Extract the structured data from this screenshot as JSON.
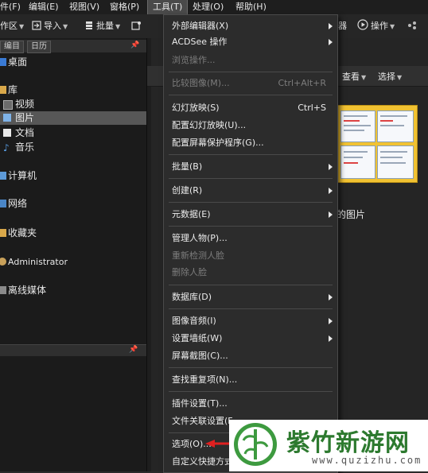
{
  "menubar": {
    "items": [
      {
        "label": "件(F)"
      },
      {
        "label": "编辑(E)"
      },
      {
        "label": "视图(V)"
      },
      {
        "label": "窗格(P)"
      },
      {
        "label": "工具(T)"
      },
      {
        "label": "处理(O)"
      },
      {
        "label": "帮助(H)"
      }
    ]
  },
  "toolbar": {
    "workspace_label": "作区",
    "import_label": "导入",
    "batch_label": "批量",
    "right_partial_label": "器",
    "action_label": "操作"
  },
  "left_panel": {
    "tabs": [
      "编目",
      "日历"
    ],
    "tree": [
      {
        "label": "桌面"
      },
      {
        "label": "库"
      },
      {
        "label": "视频"
      },
      {
        "label": "图片",
        "selected": true
      },
      {
        "label": "文档"
      },
      {
        "label": "音乐"
      },
      {
        "label": "计算机"
      },
      {
        "label": "网络"
      },
      {
        "label": "收藏夹"
      },
      {
        "label": "Administrator"
      },
      {
        "label": "离线媒体"
      }
    ]
  },
  "content": {
    "view_label": "查看",
    "select_label": "选择",
    "thumb_caption": "的图片"
  },
  "tools_menu": {
    "items": [
      {
        "label": "外部编辑器(X)",
        "submenu": true
      },
      {
        "label": "ACDSee 操作",
        "submenu": true
      },
      {
        "label": "浏览操作...",
        "disabled": true
      },
      {
        "label": "比较图像(M)...",
        "shortcut": "Ctrl+Alt+R",
        "disabled": true
      },
      {
        "label": "幻灯放映(S)",
        "shortcut": "Ctrl+S"
      },
      {
        "label": "配置幻灯放映(U)..."
      },
      {
        "label": "配置屏幕保护程序(G)..."
      },
      {
        "label": "批量(B)",
        "submenu": true
      },
      {
        "label": "创建(R)",
        "submenu": true
      },
      {
        "label": "元数据(E)",
        "submenu": true
      },
      {
        "label": "管理人物(P)..."
      },
      {
        "label": "重新检测人脸",
        "disabled": true
      },
      {
        "label": "删除人脸",
        "disabled": true
      },
      {
        "label": "数据库(D)",
        "submenu": true
      },
      {
        "label": "图像音频(I)",
        "submenu": true
      },
      {
        "label": "设置墙纸(W)",
        "submenu": true
      },
      {
        "label": "屏幕截图(C)..."
      },
      {
        "label": "查找重复项(N)..."
      },
      {
        "label": "插件设置(T)..."
      },
      {
        "label": "文件关联设置(F..."
      },
      {
        "label": "选项(O)..."
      },
      {
        "label": "自定义快捷方式"
      }
    ]
  },
  "watermark": {
    "title": "紫竹新游网",
    "url": "www.quzizhu.com"
  },
  "colors": {
    "menu_bg": "#2c2c2c",
    "selected_row": "#575757",
    "watermark_green": "#2d7a2f",
    "arrow_red": "#e02020"
  }
}
